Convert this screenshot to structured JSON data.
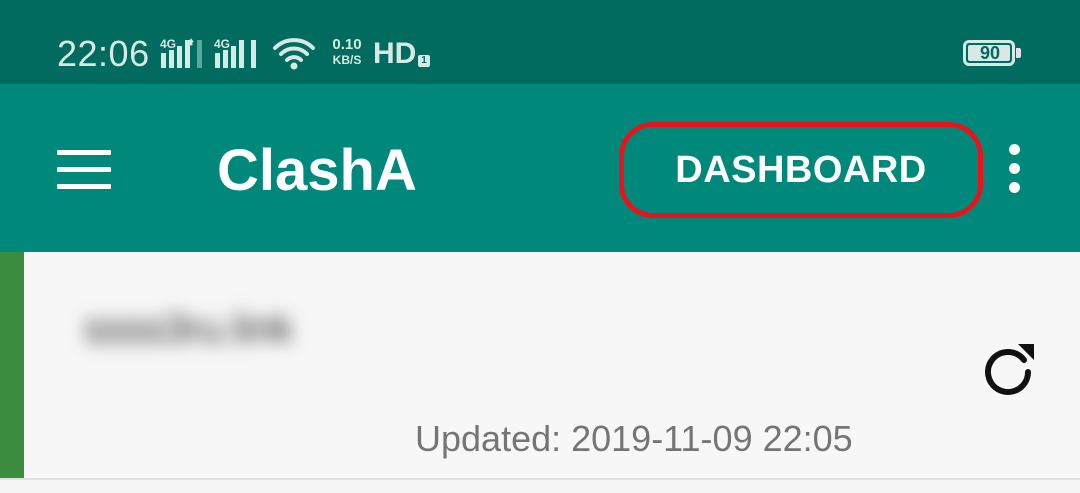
{
  "status_bar": {
    "time": "22:06",
    "signal_1_label": "4G",
    "signal_2_label": "4G",
    "net_speed_value": "0.10",
    "net_speed_unit": "KB/S",
    "hd_label": "HD",
    "hd_sub": "1",
    "battery_level": "90",
    "icons": [
      "signal-4g-icon",
      "signal-4g-icon",
      "wifi-icon",
      "hd-voice-icon",
      "battery-icon"
    ]
  },
  "app_bar": {
    "menu_icon": "hamburger-menu-icon",
    "title": "ClashA",
    "dashboard_label": "DASHBOARD",
    "overflow_icon": "more-vert-icon"
  },
  "profile": {
    "name": "ssss3ru.link",
    "updated": "Updated: 2019-11-09 22:05",
    "refresh_icon": "refresh-icon",
    "active": true
  },
  "colors": {
    "status_bar": "#006b5e",
    "app_bar": "#00897b",
    "highlight": "#e8131c",
    "active_indicator": "#3c8c40",
    "card_background": "#f7f7f7"
  }
}
